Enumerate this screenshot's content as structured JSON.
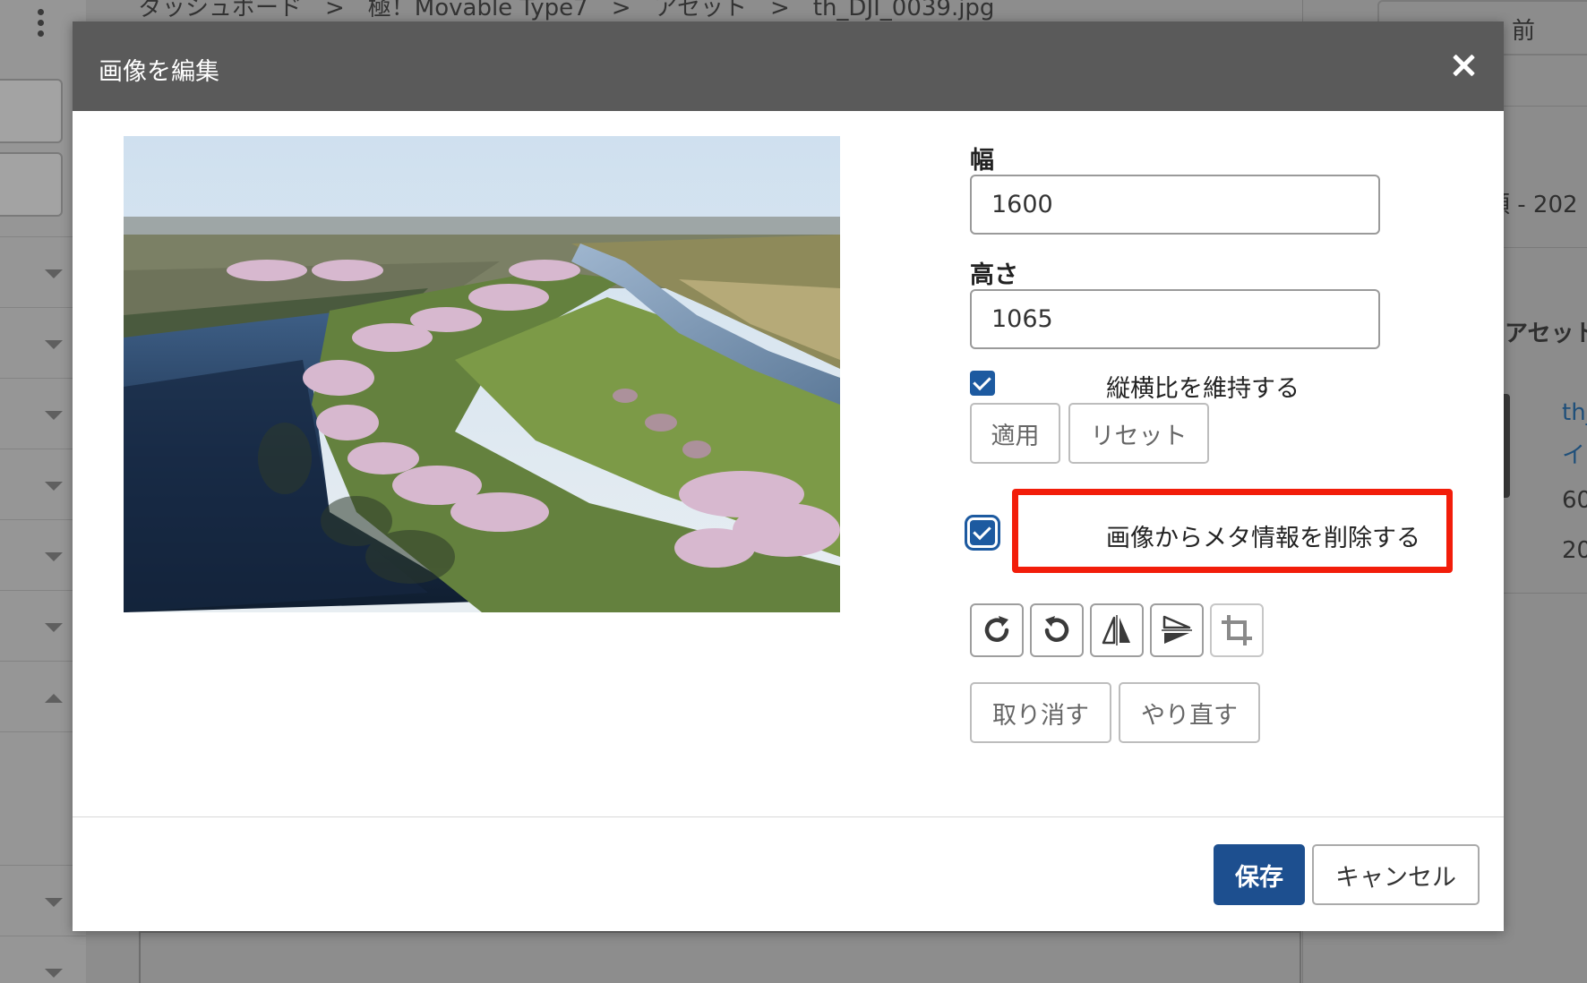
{
  "background": {
    "breadcrumb": "ダッシュボード　>　極！Movable Type7　>　アセット　>　th_DJI_0039.jpg",
    "right_panel": {
      "prev_label": "前",
      "date_fragment": "順 - 202",
      "section_fragment": "アセット",
      "link_fragment_1": "th_",
      "link_fragment_2": "イ",
      "num_fragment_1": "60",
      "num_fragment_2": "20"
    }
  },
  "modal": {
    "title": "画像を編集",
    "width_label": "幅",
    "width_value": "1600",
    "height_label": "高さ",
    "height_value": "1065",
    "keep_aspect_label": "縦横比を維持する",
    "keep_aspect_checked": true,
    "apply_label": "適用",
    "reset_label": "リセット",
    "remove_meta_label": "画像からメタ情報を削除する",
    "remove_meta_checked": true,
    "undo_label": "取り消す",
    "redo_label": "やり直す",
    "save_label": "保存",
    "cancel_label": "キャンセル"
  },
  "colors": {
    "header_bg": "#5a5a5a",
    "primary": "#1d4f8f",
    "highlight": "#f21d0a"
  },
  "icons": {
    "close": "close-icon",
    "rotate_right": "rotate-clockwise-icon",
    "rotate_left": "rotate-counterclockwise-icon",
    "flip_horizontal": "flip-horizontal-icon",
    "flip_vertical": "flip-vertical-icon",
    "crop": "crop-icon"
  }
}
